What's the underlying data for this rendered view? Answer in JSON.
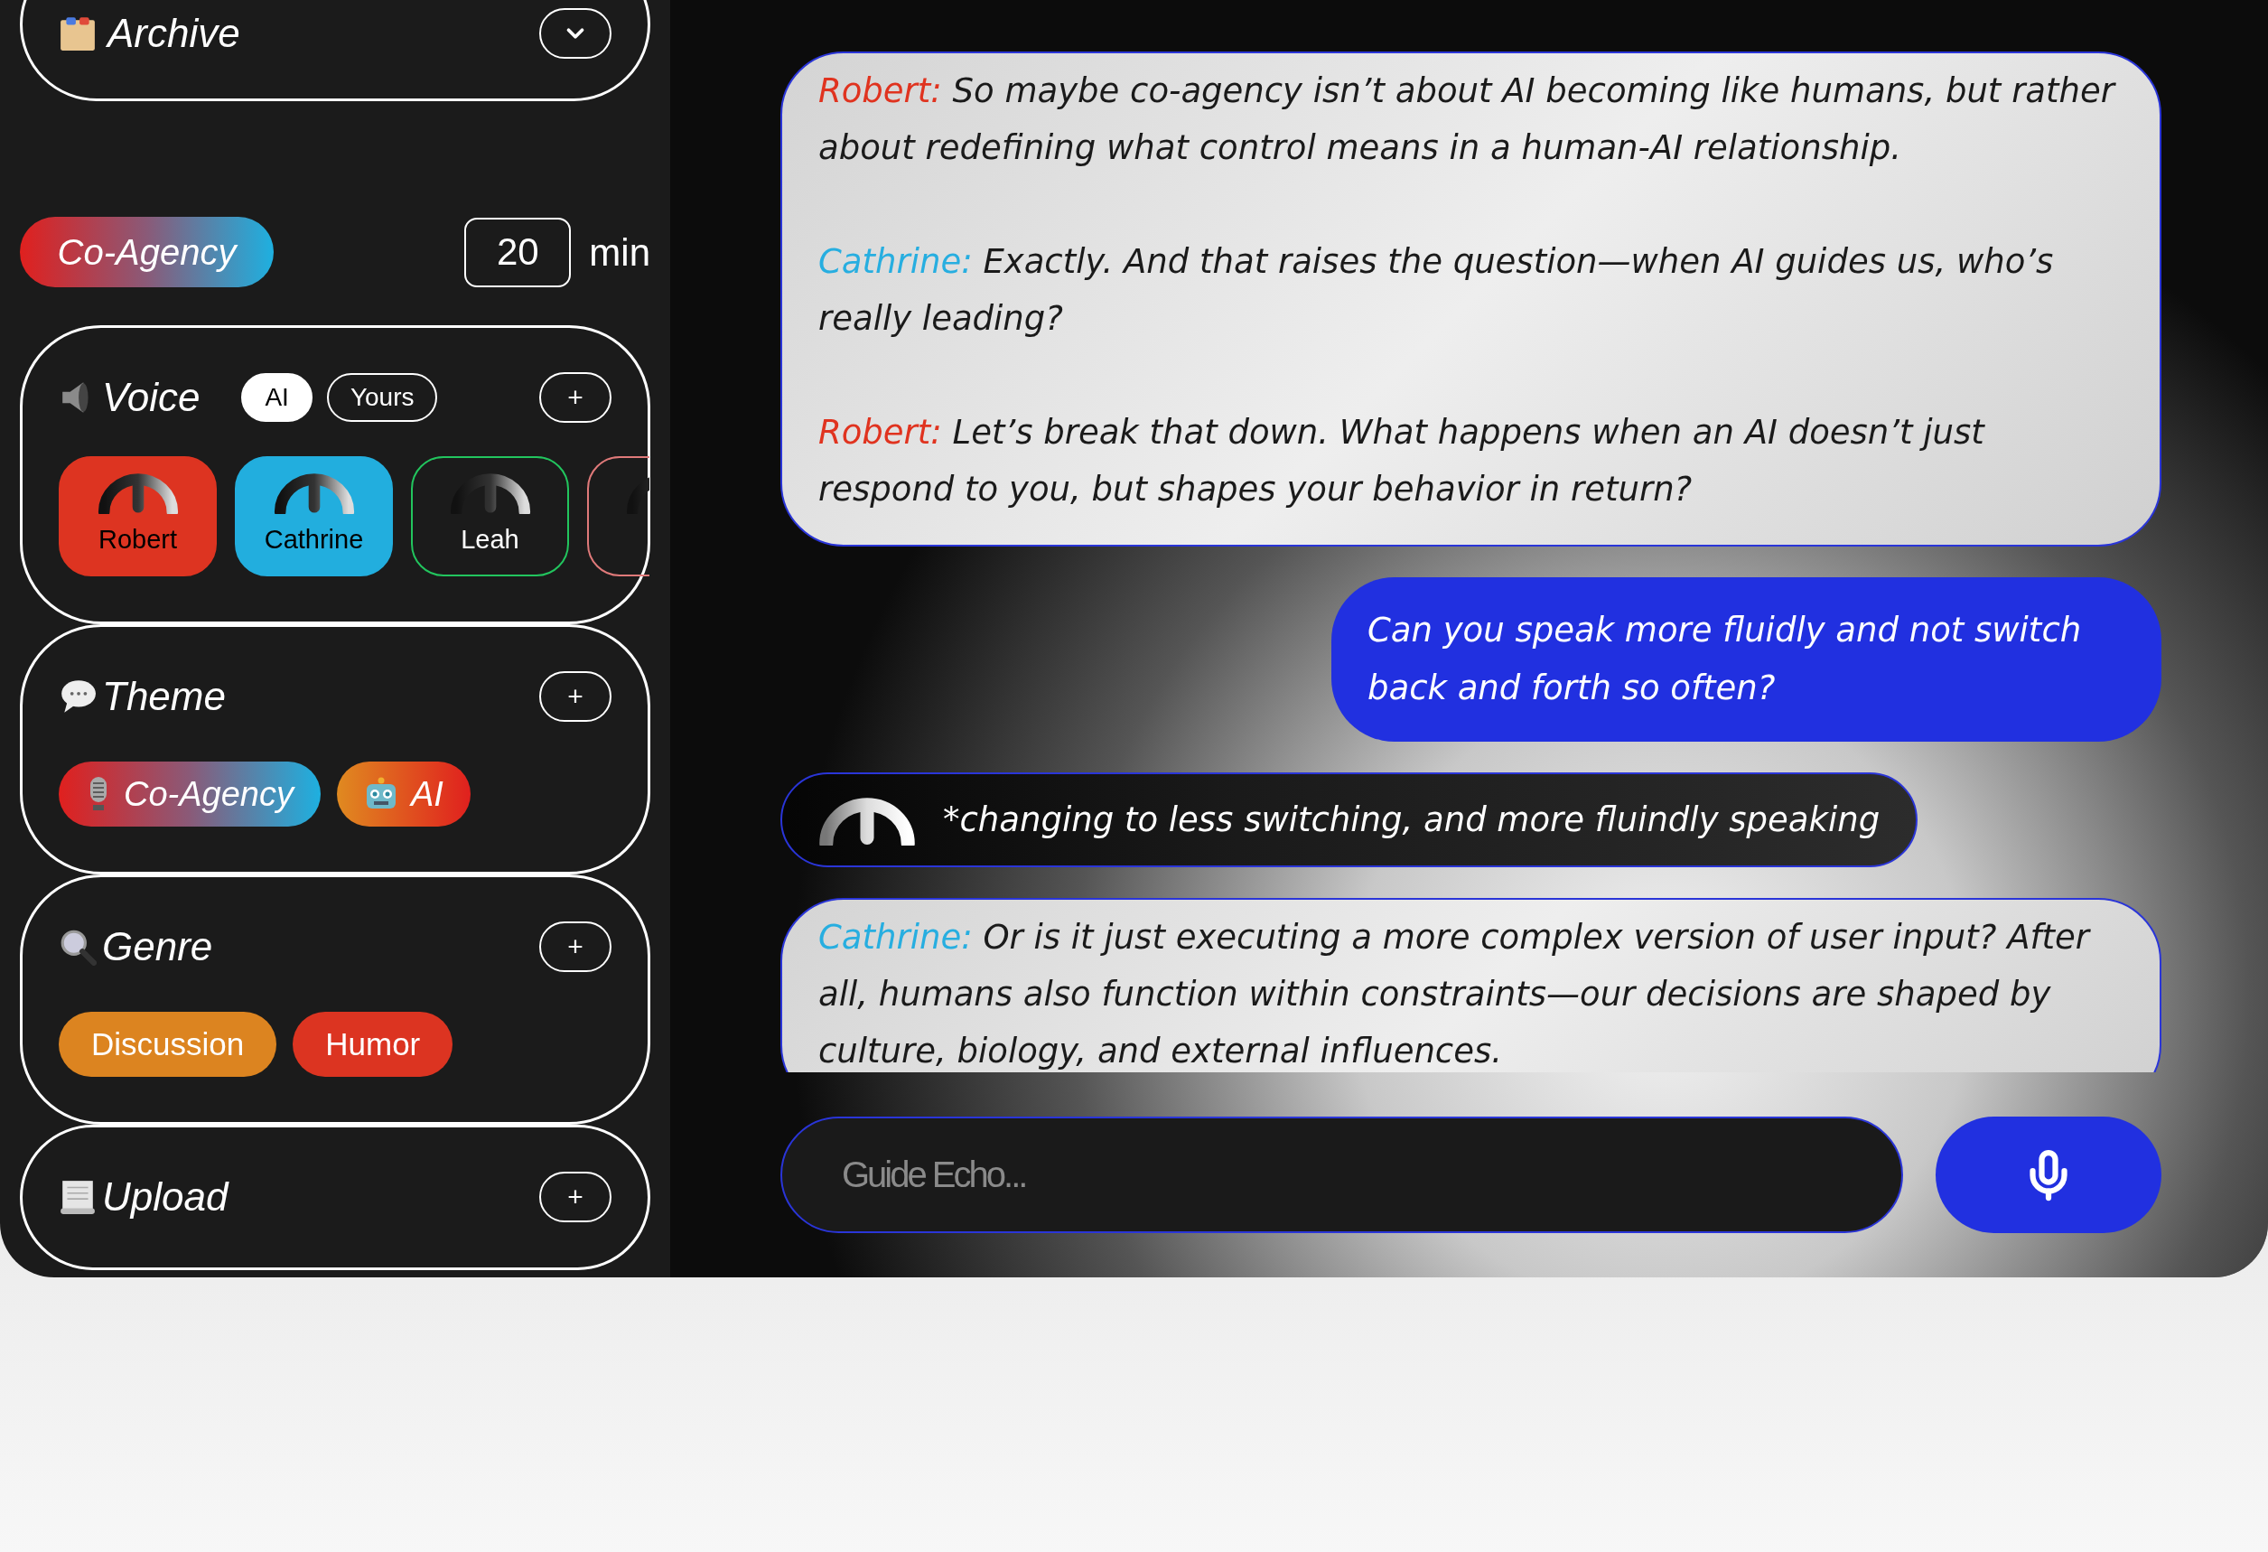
{
  "sidebar": {
    "archive": {
      "title": "Archive"
    },
    "session": {
      "topic": "Co-Agency",
      "duration": "20",
      "unit": "min"
    },
    "sections": [
      {
        "kind": "voice",
        "title": "Voice",
        "add": "+",
        "toggle": [
          {
            "label": "AI",
            "selected": true
          },
          {
            "label": "Yours",
            "selected": false
          }
        ],
        "voices": [
          {
            "name": "Robert",
            "color": "#dd3421",
            "selected": true
          },
          {
            "name": "Cathrine",
            "color": "#22aede",
            "selected": true
          },
          {
            "name": "Leah",
            "color": "#22c55e",
            "selected": false
          },
          {
            "color": "#e07a7a",
            "selected": false
          }
        ]
      },
      {
        "kind": "theme",
        "title": "Theme",
        "add": "+",
        "tags": [
          {
            "label": "Co-Agency",
            "kind": "mic"
          },
          {
            "label": "AI",
            "kind": "robot"
          }
        ]
      },
      {
        "kind": "genre",
        "title": "Genre",
        "add": "+",
        "tags": [
          {
            "label": "Discussion",
            "color": "#dc8420"
          },
          {
            "label": "Humor",
            "color": "#dc3421"
          }
        ]
      },
      {
        "kind": "upload",
        "title": "Upload",
        "add": "+"
      }
    ]
  },
  "chat": {
    "messages": [
      {
        "kind": "transcript",
        "lines": [
          {
            "speaker": "Robert:",
            "color": "#e0331f",
            "text": "So maybe co-agency isn’t about AI becoming like humans, but rather about redefining what control means in a human-AI relationship."
          },
          {
            "speaker": "Cathrine:",
            "color": "#27aee0",
            "text": "Exactly. And that raises the question—when AI guides us, who’s really leading?"
          },
          {
            "speaker": "Robert:",
            "color": "#e0331f",
            "text": "Let’s break that down. What happens when an AI doesn’t just respond to you, but shapes your behavior in return?"
          }
        ]
      },
      {
        "kind": "user",
        "text": "Can you speak more fluidly and not switch back and forth so often?"
      },
      {
        "kind": "status",
        "text": "*changing to less switching, and more fluindly speaking"
      },
      {
        "kind": "transcript",
        "lines": [
          {
            "speaker": "Cathrine:",
            "color": "#27aee0",
            "text": "Or is it just executing a more complex version of user input? After all, humans also function within constraints—our decisions are shaped by culture, biology, and external influences."
          }
        ]
      }
    ],
    "input": {
      "placeholder": "Guide Echo..."
    }
  }
}
